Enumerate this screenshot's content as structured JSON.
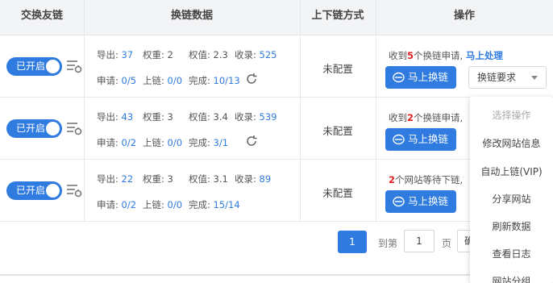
{
  "header": {
    "col_exchange": "交换友链",
    "col_data": "换链数据",
    "col_method": "上下链方式",
    "col_action": "操作"
  },
  "labels": {
    "export": "导出:",
    "weight": "权重:",
    "weight_value": "权值:",
    "indexed": "收录:",
    "apply": "申请:",
    "uplink": "上链:",
    "done": "完成:",
    "not_configured": "未配置",
    "swap_button": "马上换链",
    "toggle_on": "已开启"
  },
  "rows": [
    {
      "export": "37",
      "weight": "2",
      "weight_value": "2.3",
      "indexed": "525",
      "apply": "0/5",
      "uplink": "0/0",
      "done": "10/13",
      "msg_pre": "收到",
      "msg_count": "5",
      "msg_post": "个换链申请,",
      "msg_link": "马上处理"
    },
    {
      "export": "43",
      "weight": "3",
      "weight_value": "3.4",
      "indexed": "539",
      "apply": "0/2",
      "uplink": "0/0",
      "done": "3/1",
      "msg_pre": "收到",
      "msg_count": "2",
      "msg_post": "个换链申请,",
      "msg_link": ""
    },
    {
      "export": "22",
      "weight": "3",
      "weight_value": "3.1",
      "indexed": "89",
      "apply": "0/2",
      "uplink": "0/0",
      "done": "15/14",
      "msg_pre": "",
      "msg_count": "2",
      "msg_post": "个网站等待下链,",
      "msg_link": ""
    }
  ],
  "select": {
    "value": "换链要求"
  },
  "dropdown": {
    "items": [
      "选择操作",
      "修改网站信息",
      "自动上链(VIP)",
      "分享网站",
      "刷新数据",
      "查看日志",
      "网站分组"
    ]
  },
  "pager": {
    "current": "1",
    "goto_label": "到第",
    "input_value": "1",
    "page_label": "页",
    "go_label": "确定"
  },
  "colors": {
    "accent": "#2f7be0",
    "alert": "#e02020"
  }
}
